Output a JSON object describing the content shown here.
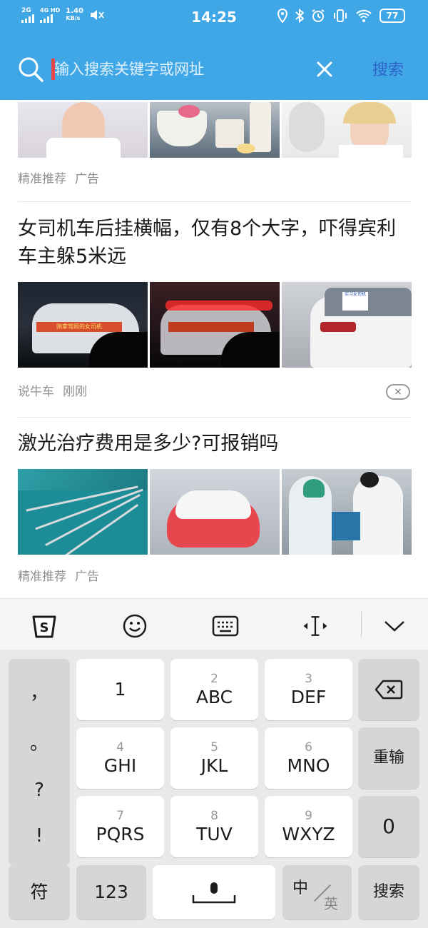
{
  "status_bar": {
    "sig1_label": "2G",
    "sig2_label": "4G HD",
    "net_speed_value": "1.40",
    "net_speed_unit": "KB/s",
    "time": "14:25",
    "battery": "77"
  },
  "search": {
    "placeholder": "输入搜索关键字或网址",
    "button_label": "搜索"
  },
  "feed": {
    "items": [
      {
        "title": "",
        "source": "精准推荐",
        "tag": "广告"
      },
      {
        "title": "女司机车后挂横幅，仅有8个大字，吓得宾利车主躲5米远",
        "source": "说牛车",
        "time": "刚刚",
        "banner_text": "刚拿驾照的女司机",
        "sign_text": "实习女司机"
      },
      {
        "title": "激光治疗费用是多少?可报销吗",
        "source": "精准推荐",
        "tag": "广告"
      }
    ],
    "dismiss_glyph": "×"
  },
  "keyboard": {
    "toolbar": [
      "sogou-logo-icon",
      "emoji-icon",
      "keyboard-icon",
      "cursor-move-icon",
      "collapse-icon"
    ],
    "punctuation": [
      "，",
      "。",
      "?",
      "!"
    ],
    "keys": [
      {
        "num": "",
        "main": "1"
      },
      {
        "num": "2",
        "main": "ABC"
      },
      {
        "num": "3",
        "main": "DEF"
      },
      {
        "num": "4",
        "main": "GHI"
      },
      {
        "num": "5",
        "main": "JKL"
      },
      {
        "num": "6",
        "main": "MNO"
      },
      {
        "num": "7",
        "main": "PQRS"
      },
      {
        "num": "8",
        "main": "TUV"
      },
      {
        "num": "9",
        "main": "WXYZ"
      }
    ],
    "reinput_label": "重输",
    "zero_label": "0",
    "symbols_label": "符",
    "numbers_label": "123",
    "lang_zh": "中",
    "lang_en": "英",
    "enter_label": "搜索"
  },
  "colors": {
    "header_bg": "#3fa7e6",
    "search_button": "#2d63c8",
    "cursor": "#e5464a"
  }
}
